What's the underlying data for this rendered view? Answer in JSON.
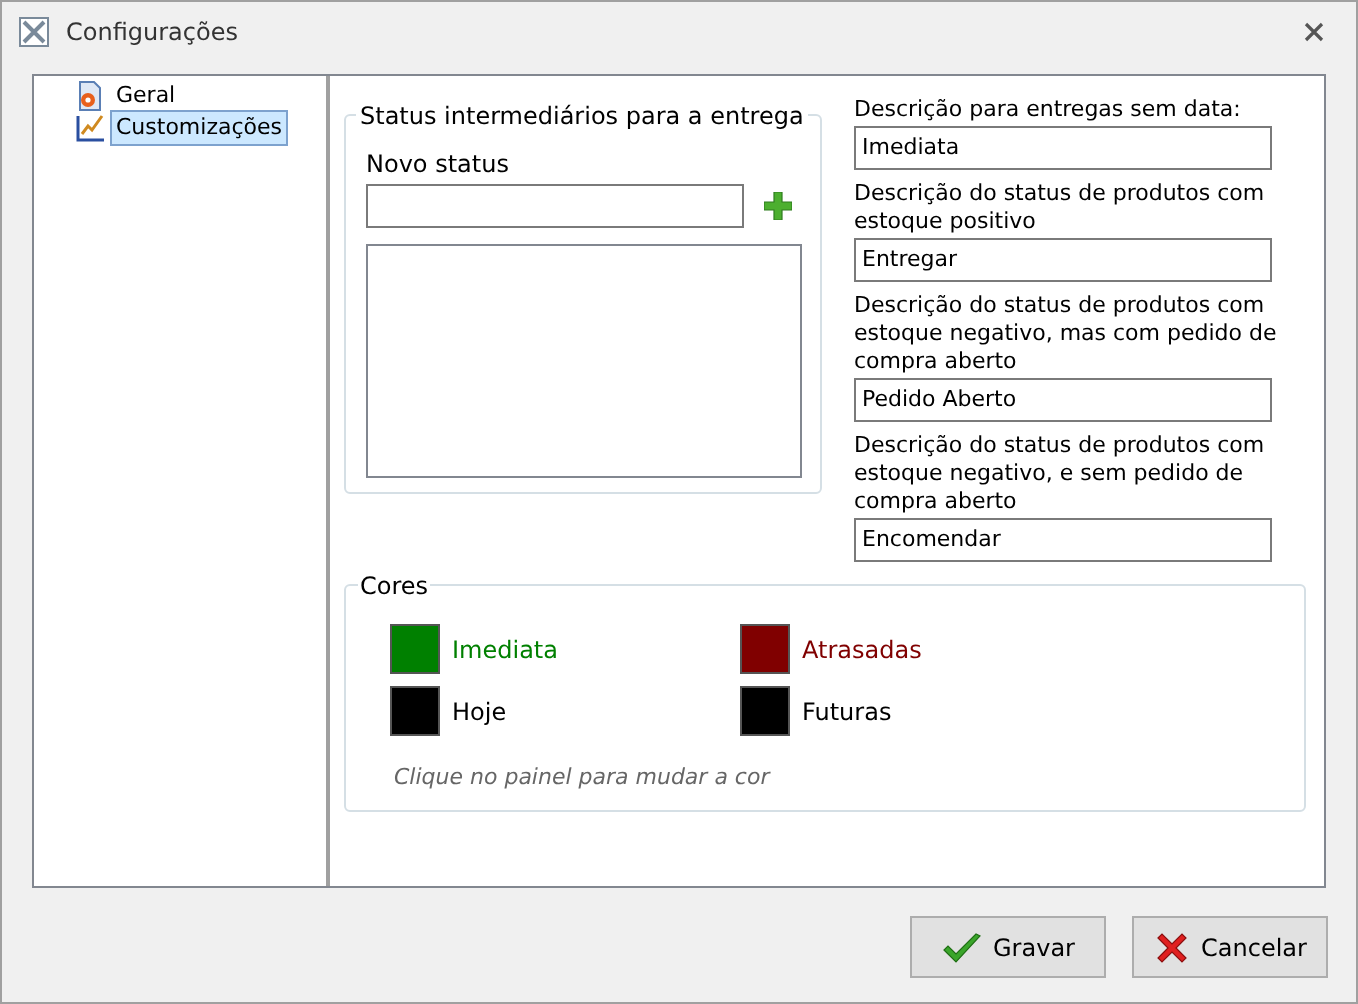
{
  "window": {
    "title": "Configurações"
  },
  "tree": {
    "items": [
      {
        "label": "Geral",
        "kind": "general",
        "selected": false
      },
      {
        "label": "Customizações",
        "kind": "custom",
        "selected": true
      }
    ]
  },
  "status_group": {
    "title": "Status intermediários para a entrega",
    "new_status_label": "Novo status"
  },
  "descriptions": [
    {
      "label": "Descrição para entregas sem data:",
      "value": "Imediata"
    },
    {
      "label": "Descrição do status de produtos com estoque positivo",
      "value": "Entregar"
    },
    {
      "label": "Descrição do status de produtos com estoque negativo, mas com pedido de compra aberto",
      "value": "Pedido Aberto"
    },
    {
      "label": "Descrição do status de produtos com estoque negativo, e sem pedido de compra aberto",
      "value": "Encomendar"
    }
  ],
  "colors_group": {
    "title": "Cores",
    "items": [
      {
        "label": "Imediata",
        "color": "#008000"
      },
      {
        "label": "Atrasadas",
        "color": "#800000"
      },
      {
        "label": "Hoje",
        "color": "#000000"
      },
      {
        "label": "Futuras",
        "color": "#000000"
      }
    ],
    "hint": "Clique no painel para mudar a cor"
  },
  "buttons": [
    {
      "kind": "save",
      "label": "Gravar"
    },
    {
      "kind": "cancel",
      "label": "Cancelar"
    }
  ]
}
